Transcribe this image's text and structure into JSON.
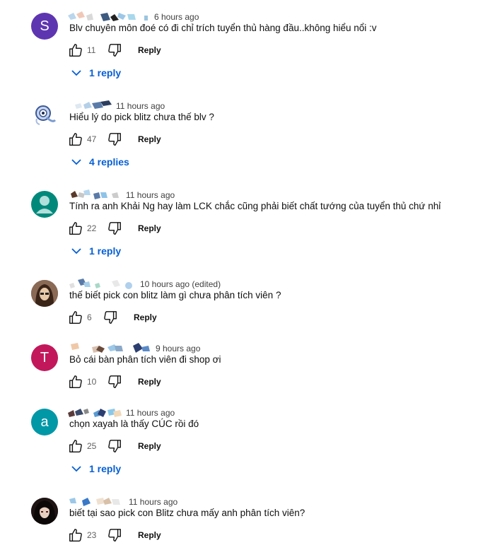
{
  "comments": [
    {
      "avatar": {
        "type": "letter",
        "letter": "S",
        "color": "#5e35b1"
      },
      "time": "6 hours ago",
      "text": "Blv chuyên môn đoé có đi chỉ trích tuyển thủ hàng đầu..không hiểu nổi :v",
      "likes": "11",
      "reply_label": "Reply",
      "replies_label": "1 reply"
    },
    {
      "avatar": {
        "type": "image",
        "name": "cartoon-avatar"
      },
      "time": "11 hours ago",
      "text": "Hiểu lý do pick blitz chưa thế blv ?",
      "likes": "47",
      "reply_label": "Reply",
      "replies_label": "4 replies"
    },
    {
      "avatar": {
        "type": "default",
        "color": "#00897b"
      },
      "time": "11 hours ago",
      "text": "Tính ra anh Khải Ng hay làm LCK chắc cũng phải biết chất tướng của tuyển thủ chứ nhỉ",
      "likes": "22",
      "reply_label": "Reply",
      "replies_label": "1 reply"
    },
    {
      "avatar": {
        "type": "image",
        "name": "photo-avatar"
      },
      "time": "10 hours ago (edited)",
      "text": "thế biết pick con blitz làm gì chưa phân tích viên ?",
      "likes": "6",
      "reply_label": "Reply",
      "replies_label": ""
    },
    {
      "avatar": {
        "type": "letter",
        "letter": "T",
        "color": "#c2185b"
      },
      "time": "9 hours ago",
      "text": "Bỏ cái bàn phân tích viên đi shop ơi",
      "likes": "10",
      "reply_label": "Reply",
      "replies_label": ""
    },
    {
      "avatar": {
        "type": "letter",
        "letter": "a",
        "color": "#0097a7"
      },
      "time": "11 hours ago",
      "text": "chọn xayah là thấy CÚC rồi đó",
      "likes": "25",
      "reply_label": "Reply",
      "replies_label": "1 reply"
    },
    {
      "avatar": {
        "type": "image",
        "name": "anime-avatar"
      },
      "time": "11 hours ago",
      "text": "biết tại sao pick con Blitz chưa mấy anh phân tích viên?",
      "likes": "23",
      "reply_label": "Reply",
      "replies_label": ""
    }
  ]
}
